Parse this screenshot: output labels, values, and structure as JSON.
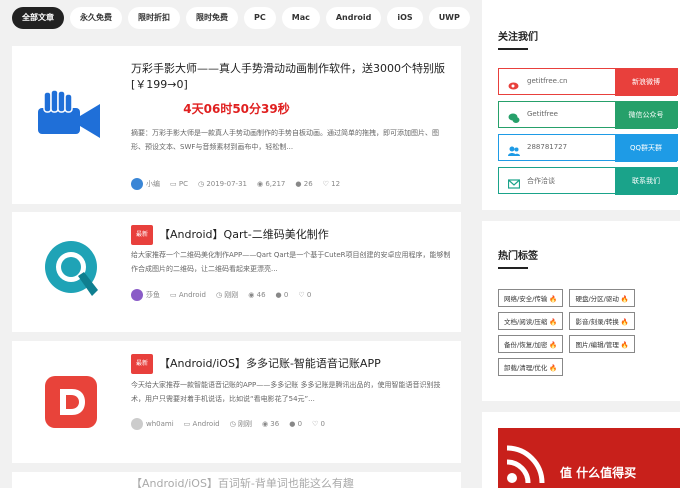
{
  "tabs": [
    "全部文章",
    "永久免费",
    "限时折扣",
    "限时免费",
    "PC",
    "Mac",
    "Android",
    "iOS",
    "UWP"
  ],
  "articles": [
    {
      "title": "万彩手影大师——真人手势滑动动画制作软件，送3000个特别版[￥199→0]",
      "countdown": "4天06时50分39秒",
      "excerpt": "摘要：万彩手影大师是一款真人手势动画制作的手势自板动画。通过简单的拖拽，即可添加图片、图形、预设文本、SWF与音频素材到画布中，轻松制...",
      "author": "小编",
      "platform": "PC",
      "date": "2019-07-31",
      "views": "6,217",
      "comments": "26",
      "likes": "12"
    },
    {
      "badge": "最新",
      "title": "【Android】Qart-二维码美化制作",
      "excerpt": "给大家推荐一个二维码美化制作APP——Qart Qart是一个基于CuteR项目创建的安卓应用程序，能够制作合成图片的二维码，让二维码看起来更漂亮...",
      "author": "莎鱼",
      "platform": "Android",
      "date": "刚刚",
      "views": "46",
      "comments": "0",
      "likes": "0"
    },
    {
      "badge": "最新",
      "title": "【Android/iOS】多多记账-智能语音记账APP",
      "excerpt": "今天给大家推荐一款智能语音记账的APP——多多记账 多多记账是腾讯出品的，使用智能语音识别技术，用户只需要对着手机说话，比如说“看电影花了54元”...",
      "author": "wh0ami",
      "platform": "Android",
      "date": "刚刚",
      "views": "36",
      "comments": "0",
      "likes": "0"
    },
    {
      "title": "【Android/iOS】百词斩-背单词也能这么有趣"
    }
  ],
  "follow": {
    "title": "关注我们",
    "items": [
      {
        "label": "getitfree.cn",
        "button": "新浪微博",
        "color": "#e8403c",
        "icon": "weibo-icon"
      },
      {
        "label": "Getitfree",
        "button": "微信公众号",
        "color": "#26a06a",
        "icon": "wechat-icon"
      },
      {
        "label": "288781727",
        "button": "QQ群天群",
        "color": "#1e9be6",
        "icon": "qq-group-icon"
      },
      {
        "label": "合作洽谈",
        "button": "联系我们",
        "color": "#1aa38a",
        "icon": "email-icon"
      }
    ]
  },
  "hot_tags": {
    "title": "热门标签",
    "items": [
      "网络/安全/传输",
      "硬盘/分区/驱动",
      "文档/阅读/压缩",
      "影音/刻录/转换",
      "备份/恢复/加密",
      "图片/编辑/管理",
      "卸载/清理/优化"
    ],
    "fire": "🔥"
  },
  "watermark": "值 什么值得买"
}
